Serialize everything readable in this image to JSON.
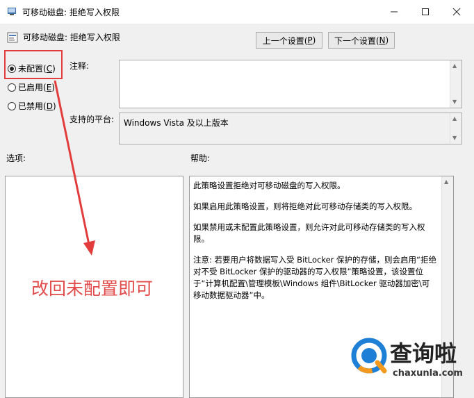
{
  "window": {
    "title": "可移动磁盘: 拒绝写入权限",
    "controls": [
      "minimize-icon",
      "maximize-icon",
      "close-icon"
    ]
  },
  "header": {
    "policy_title": "可移动磁盘: 拒绝写入权限",
    "prev_label": "上一个设置(",
    "prev_key": "P",
    "next_label": "下一个设置(",
    "next_key": "N",
    "close_paren": ")"
  },
  "state": {
    "options": [
      {
        "label": "未配置(",
        "key": "C",
        "selected": true
      },
      {
        "label": "已启用(",
        "key": "E",
        "selected": false
      },
      {
        "label": "已禁用(",
        "key": "D",
        "selected": false
      }
    ],
    "close_paren": ")"
  },
  "comment": {
    "label": "注释:",
    "value": ""
  },
  "platform": {
    "label": "支持的平台:",
    "value": "Windows Vista 及以上版本"
  },
  "options_section": {
    "label": "选项:"
  },
  "help_section": {
    "label": "帮助:",
    "paragraphs": [
      "此策略设置拒绝对可移动磁盘的写入权限。",
      "如果启用此策略设置，则将拒绝对此可移动存储类的写入权限。",
      "如果禁用或未配置此策略设置，则允许对此可移动存储类的写入权限。",
      "注意: 若要用户将数据写入受 BitLocker 保护的存储，则会启用“拒绝对不受 BitLocker 保护的驱动器的写入权限”策略设置，该设置位于“计算机配置\\管理模板\\Windows 组件\\BitLocker 驱动器加密\\可移动数据驱动器”中。"
    ]
  },
  "annotation": {
    "text": "改回未配置即可",
    "color": "#e24a4a"
  },
  "watermark": {
    "brand": "查询啦",
    "url": "chaxunla.com"
  },
  "colors": {
    "accent_red": "#e23c3c",
    "watermark_blue": "#1e7fd6",
    "watermark_orange": "#f39a1e"
  }
}
